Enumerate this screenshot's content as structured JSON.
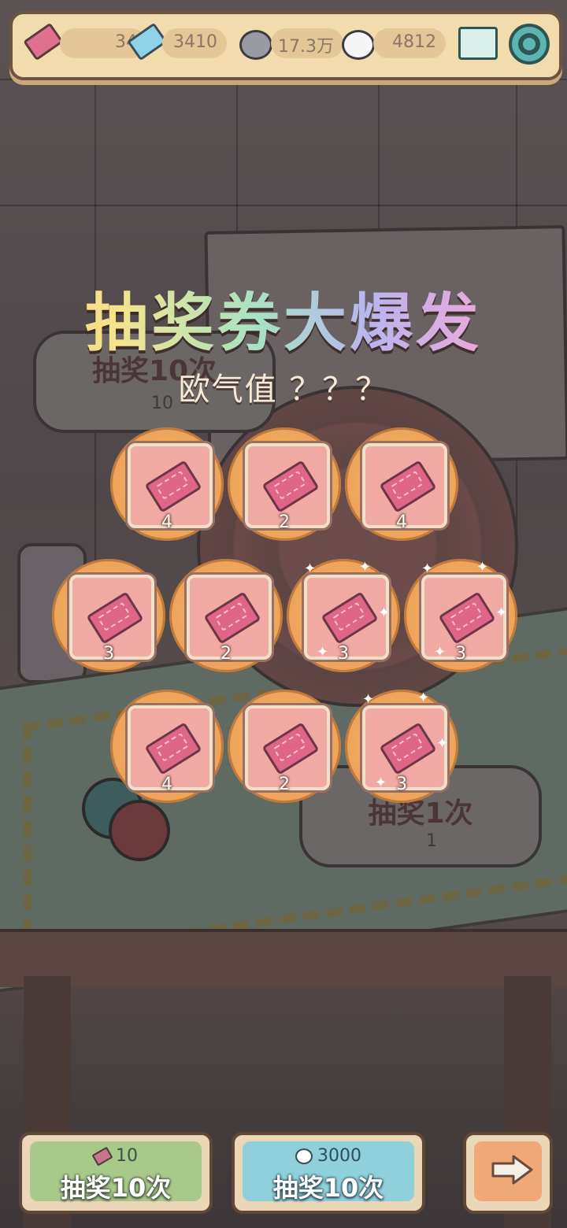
{
  "topbar": {
    "tickets": "34",
    "star_tickets": "3410",
    "bubbles": "17.3万",
    "spirits": "4812",
    "icons": [
      "pink-ticket-icon",
      "blue-star-ticket-icon",
      "grey-bubble-icon",
      "white-ghost-bubble-icon",
      "mail-icon",
      "gear-icon"
    ]
  },
  "banner": {
    "title": "抽奖券大爆发",
    "luck": "欧气值 ？？？"
  },
  "background_signs": {
    "left_label": "抽奖10次",
    "left_cost": "10",
    "right_label": "抽奖1次",
    "right_cost": "1"
  },
  "rewards": [
    {
      "count": "4",
      "sparkle": false
    },
    {
      "count": "2",
      "sparkle": false
    },
    {
      "count": "4",
      "sparkle": false
    },
    {
      "count": "3",
      "sparkle": false
    },
    {
      "count": "2",
      "sparkle": false
    },
    {
      "count": "3",
      "sparkle": true
    },
    {
      "count": "3",
      "sparkle": true
    },
    {
      "count": "4",
      "sparkle": false
    },
    {
      "count": "2",
      "sparkle": false
    },
    {
      "count": "3",
      "sparkle": true
    }
  ],
  "buttons": {
    "draw_ticket": {
      "cost": "10",
      "label": "抽奖10次"
    },
    "draw_bubble": {
      "cost": "3000",
      "label": "抽奖10次"
    },
    "next_icon": "arrow-right-icon"
  },
  "colors": {
    "topbar_bg": "#f2dcad",
    "reward_circle": "#eea45a",
    "card_bg": "#f0a9a3",
    "green_button": "#a8c98a",
    "blue_button": "#8fd0da",
    "orange_button": "#f0a878"
  }
}
